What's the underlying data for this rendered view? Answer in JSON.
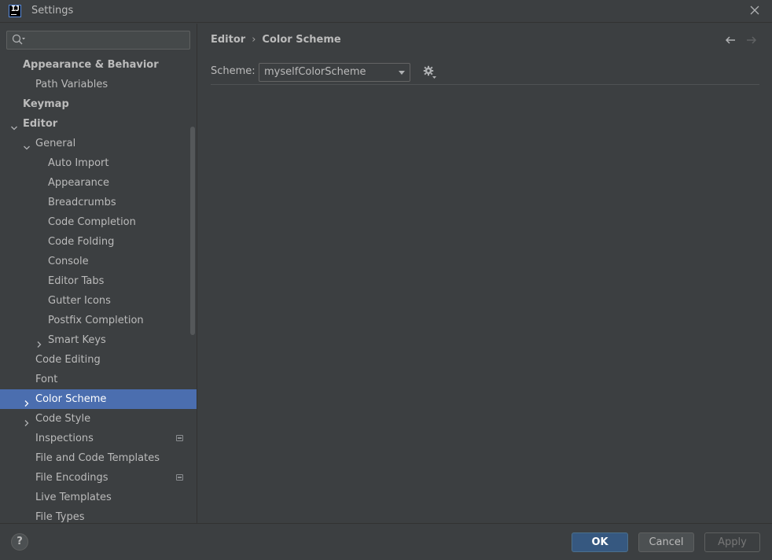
{
  "window": {
    "title": "Settings",
    "logo_text": "IJ"
  },
  "search": {
    "value": "",
    "placeholder": ""
  },
  "tree": {
    "items": [
      {
        "label": "Appearance & Behavior",
        "bold": true,
        "level": 0,
        "arrow": "",
        "badge": false,
        "selected": false
      },
      {
        "label": "Path Variables",
        "bold": false,
        "level": 1,
        "arrow": "",
        "badge": false,
        "selected": false
      },
      {
        "label": "Keymap",
        "bold": true,
        "level": 0,
        "arrow": "",
        "badge": false,
        "selected": false
      },
      {
        "label": "Editor",
        "bold": true,
        "level": 0,
        "arrow": "expanded",
        "badge": false,
        "selected": false
      },
      {
        "label": "General",
        "bold": false,
        "level": 1,
        "arrow": "expanded",
        "badge": false,
        "selected": false
      },
      {
        "label": "Auto Import",
        "bold": false,
        "level": 2,
        "arrow": "",
        "badge": false,
        "selected": false
      },
      {
        "label": "Appearance",
        "bold": false,
        "level": 2,
        "arrow": "",
        "badge": false,
        "selected": false
      },
      {
        "label": "Breadcrumbs",
        "bold": false,
        "level": 2,
        "arrow": "",
        "badge": false,
        "selected": false
      },
      {
        "label": "Code Completion",
        "bold": false,
        "level": 2,
        "arrow": "",
        "badge": false,
        "selected": false
      },
      {
        "label": "Code Folding",
        "bold": false,
        "level": 2,
        "arrow": "",
        "badge": false,
        "selected": false
      },
      {
        "label": "Console",
        "bold": false,
        "level": 2,
        "arrow": "",
        "badge": false,
        "selected": false
      },
      {
        "label": "Editor Tabs",
        "bold": false,
        "level": 2,
        "arrow": "",
        "badge": false,
        "selected": false
      },
      {
        "label": "Gutter Icons",
        "bold": false,
        "level": 2,
        "arrow": "",
        "badge": false,
        "selected": false
      },
      {
        "label": "Postfix Completion",
        "bold": false,
        "level": 2,
        "arrow": "",
        "badge": false,
        "selected": false
      },
      {
        "label": "Smart Keys",
        "bold": false,
        "level": 2,
        "arrow": "collapsed",
        "badge": false,
        "selected": false
      },
      {
        "label": "Code Editing",
        "bold": false,
        "level": 1,
        "arrow": "",
        "badge": false,
        "selected": false
      },
      {
        "label": "Font",
        "bold": false,
        "level": 1,
        "arrow": "",
        "badge": false,
        "selected": false
      },
      {
        "label": "Color Scheme",
        "bold": false,
        "level": 1,
        "arrow": "collapsed",
        "badge": false,
        "selected": true
      },
      {
        "label": "Code Style",
        "bold": false,
        "level": 1,
        "arrow": "collapsed",
        "badge": false,
        "selected": false
      },
      {
        "label": "Inspections",
        "bold": false,
        "level": 1,
        "arrow": "",
        "badge": true,
        "selected": false
      },
      {
        "label": "File and Code Templates",
        "bold": false,
        "level": 1,
        "arrow": "",
        "badge": false,
        "selected": false
      },
      {
        "label": "File Encodings",
        "bold": false,
        "level": 1,
        "arrow": "",
        "badge": true,
        "selected": false
      },
      {
        "label": "Live Templates",
        "bold": false,
        "level": 1,
        "arrow": "",
        "badge": false,
        "selected": false
      },
      {
        "label": "File Types",
        "bold": false,
        "level": 1,
        "arrow": "",
        "badge": false,
        "selected": false
      }
    ]
  },
  "breadcrumb": {
    "parent": "Editor",
    "separator": "›",
    "current": "Color Scheme"
  },
  "scheme": {
    "label": "Scheme:",
    "selected": "myselfColorScheme"
  },
  "buttons": {
    "help": "?",
    "ok": "OK",
    "cancel": "Cancel",
    "apply": "Apply"
  },
  "colors": {
    "background": "#3c3f41",
    "selection": "#4b6eaf",
    "ok_button": "#365880",
    "text": "#bbbbbb"
  },
  "icons": {
    "logo": "intellij-logo-icon",
    "close": "close-icon",
    "search": "search-icon",
    "back": "arrow-left-icon",
    "forward": "arrow-right-icon",
    "gear": "gear-icon",
    "help": "help-icon"
  }
}
